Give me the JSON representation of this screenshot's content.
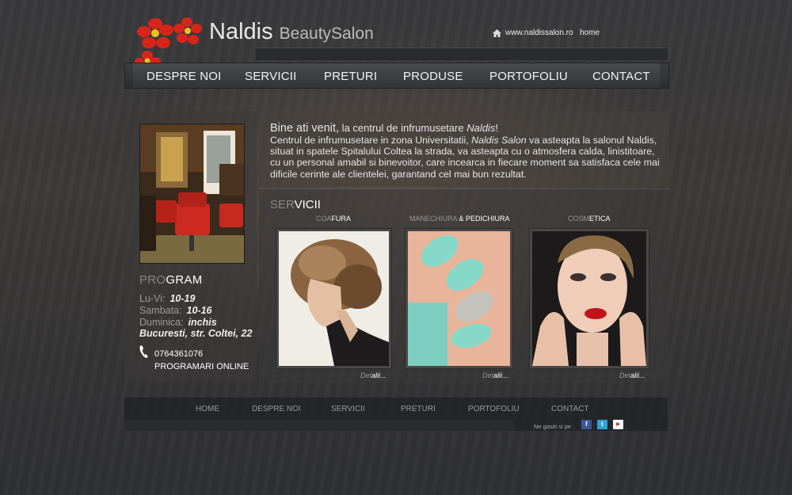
{
  "header": {
    "brand": "Naldis",
    "brand_sub": "BeautySalon",
    "site_url": "www.naldissalon.ro",
    "home_link": "home"
  },
  "mainnav": {
    "items": [
      "DESPRE NOI",
      "SERVICII",
      "PRETURI",
      "PRODUSE",
      "PORTOFOLIU",
      "CONTACT"
    ]
  },
  "sidebar": {
    "program_title_dim": "PRO",
    "program_title_bright": "GRAM",
    "hours": [
      {
        "label": "Lu-Vi:",
        "value": "10-19"
      },
      {
        "label": "Sambata:",
        "value": "10-16"
      },
      {
        "label": "Duminica:",
        "value": "inchis"
      }
    ],
    "address": "Bucuresti, str. Coltei, 22",
    "phone": "0764361076",
    "online_booking": "PROGRAMARI ONLINE"
  },
  "welcome": {
    "title_main": "Bine ati venit,",
    "title_rest": " la centrul de infrumusetare ",
    "title_brand": "Naldis",
    "title_end": "!",
    "text_1": "Centrul de infrumusetare in zona Universitatii, ",
    "text_brand": "Naldis Salon",
    "text_2": " va asteapta la salonul Naldis, situat in spatele Spitalului Coltea la strada, va asteapta cu o atmosfera calda, linistitoare, cu un personal amabil si binevoitor, care incearca in fiecare moment sa satisfaca cele mai dificile cerinte ale clientelei, garantand cel mai bun rezultat."
  },
  "services": {
    "title_dim": "SER",
    "title_bright": "VICII",
    "categories": [
      {
        "dim": "COA",
        "bright": "FURA",
        "detail_dim": "Det",
        "detail_bright": "alii..."
      },
      {
        "dim": "MANECHIURA",
        "bright": " & PEDICHIURA",
        "detail_dim": "Det",
        "detail_bright": "alii..."
      },
      {
        "dim": "COSM",
        "bright": "ETICA",
        "detail_dim": "Det",
        "detail_bright": "alii..."
      }
    ]
  },
  "footer": {
    "nav": [
      "HOME",
      "DESPRE NOI",
      "SERVICII",
      "PRETURI",
      "PORTOFOLIU",
      "CONTACT"
    ],
    "social_label": "Ne gasiti si pe :",
    "social_icons": [
      "facebook-icon",
      "twitter-icon",
      "youtube-icon"
    ]
  },
  "colors": {
    "background": "#38383a",
    "flower_red": "#d8251a",
    "facebook": "#3b5998",
    "twitter": "#2fa3d6",
    "youtube": "#c4302b"
  }
}
